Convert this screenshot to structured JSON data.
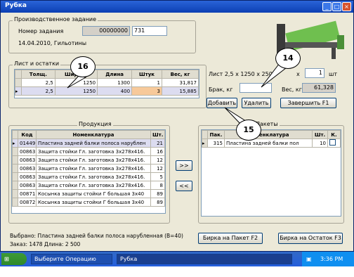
{
  "window": {
    "title": "Рубка"
  },
  "task_group": {
    "title": "Производственное задание",
    "number_label": "Номер задания",
    "number_value": "00000000",
    "number_extra": "731",
    "date_line": "14.04.2010, Гильотины"
  },
  "sheet_group": {
    "title": "Лист и остатки",
    "columns": [
      "Толщ.",
      "Ширина",
      "Длина",
      "Штук",
      "Вес, кг"
    ],
    "rows": [
      [
        "2,5",
        "1250",
        "1300",
        "1",
        "31,817"
      ],
      [
        "2,5",
        "1250",
        "400",
        "3",
        "15,885"
      ]
    ]
  },
  "sheet_info": {
    "label": "Лист 2,5 x 1250 x 2500",
    "x": "x",
    "qty": "1",
    "unit": "шт",
    "scrap_label": "Брак, кг",
    "weight_label": "Вес, кг",
    "weight_value": "61,328"
  },
  "buttons": {
    "add": "Добавить",
    "delete": "Удалить",
    "finish": "Завершить   F1",
    "move_right": ">>",
    "move_left": "<<",
    "tag_packet": "Бирка на Пакет   F2",
    "tag_rest": "Бирка на Остаток   F3"
  },
  "products_group": {
    "title": "Продукция",
    "columns": [
      "Код",
      "Номенклатура",
      "Шт."
    ],
    "rows": [
      [
        "01449",
        "Пластина задней балки полоса нарублен",
        "21"
      ],
      [
        "00863",
        "Защита стойки Гл. заготовка 3х278х416.",
        "16"
      ],
      [
        "00863",
        "Защита стойки Гл. заготовка 3х278х416.",
        "12"
      ],
      [
        "00863",
        "Защита стойки Гл. заготовка 3х278х416.",
        "12"
      ],
      [
        "00863",
        "Защита стойки Гл. заготовка 3х278х416.",
        "5"
      ],
      [
        "00863",
        "Защита стойки Гл. заготовка 3х278х416.",
        "8"
      ],
      [
        "00871",
        "Косынка защиты стойки Г большая 3х40",
        "89"
      ],
      [
        "00872",
        "Косынка защиты стойки Г большая 3х40",
        "89"
      ]
    ]
  },
  "packets_group": {
    "title": "Пакеты",
    "columns": [
      "Пак.",
      "Номенклатура",
      "Шт.",
      "К."
    ],
    "rows": [
      [
        "315",
        "Пластина задней балки пол",
        "10",
        ""
      ]
    ]
  },
  "status": {
    "selected": "Выбрано: Пластина задней балки полоса нарубленная (В=40)",
    "order": "Заказ: 1478   Длина: 2 500"
  },
  "callouts": {
    "c14": "14",
    "c15": "15",
    "c16": "16"
  },
  "taskbar": {
    "start": "Start",
    "task1": "Выберите Операцию",
    "task2": "Рубка",
    "clock": "3:36 PM"
  }
}
